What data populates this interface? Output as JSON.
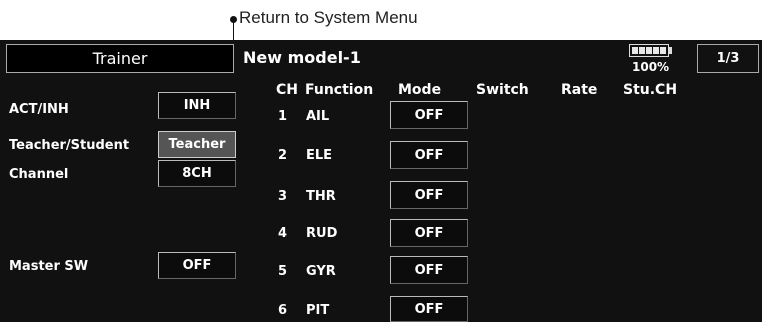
{
  "callout": {
    "label": "Return to System Menu"
  },
  "header": {
    "screen_title": "Trainer",
    "model_name": "New model-1",
    "battery_percent": "100%",
    "battery_level": 1.0,
    "page": "1/3"
  },
  "columns": {
    "ch": "CH",
    "function": "Function",
    "mode": "Mode",
    "switch": "Switch",
    "rate": "Rate",
    "stu_ch": "Stu.CH"
  },
  "settings": [
    {
      "label": "ACT/INH",
      "value": "INH"
    },
    {
      "label": "Teacher/Student",
      "value": "Teacher"
    },
    {
      "label": "Channel",
      "value": "8CH"
    },
    {
      "label": "Master SW",
      "value": "OFF"
    }
  ],
  "channels": [
    {
      "ch": "1",
      "function": "AIL",
      "mode": "OFF"
    },
    {
      "ch": "2",
      "function": "ELE",
      "mode": "OFF"
    },
    {
      "ch": "3",
      "function": "THR",
      "mode": "OFF"
    },
    {
      "ch": "4",
      "function": "RUD",
      "mode": "OFF"
    },
    {
      "ch": "5",
      "function": "GYR",
      "mode": "OFF"
    },
    {
      "ch": "6",
      "function": "PIT",
      "mode": "OFF"
    }
  ],
  "colors": {
    "screen_bg": "#111111",
    "text": "#ffffff",
    "button_bg": "#0c0c0c",
    "button_active_bg": "#555555"
  }
}
